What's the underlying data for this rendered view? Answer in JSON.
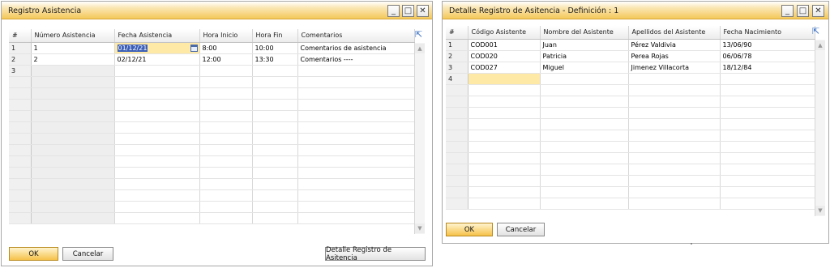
{
  "win1": {
    "title": "Registro Asistencia",
    "columns": [
      "#",
      "Número Asistencia",
      "Fecha Asistencia",
      "Hora Inicio",
      "Hora Fin",
      "Comentarios"
    ],
    "rows": [
      {
        "n": "1",
        "num": "1",
        "fecha": "01/12/21",
        "inicio": "8:00",
        "fin": "10:00",
        "coment": "Comentarios de asistencia"
      },
      {
        "n": "2",
        "num": "2",
        "fecha": "02/12/21",
        "inicio": "12:00",
        "fin": "13:30",
        "coment": "Comentarios ----"
      },
      {
        "n": "3",
        "num": "",
        "fecha": "",
        "inicio": "",
        "fin": "",
        "coment": ""
      }
    ],
    "ok_label": "OK",
    "cancel_label": "Cancelar",
    "detail_label": "Detalle Registro de Asitencia"
  },
  "win2": {
    "title": "Detalle Registro de Asitencia - Definición : 1",
    "columns": [
      "#",
      "Código Asistente",
      "Nombre del Asistente",
      "Apellidos del Asistente",
      "Fecha Nacimiento"
    ],
    "rows": [
      {
        "n": "1",
        "codigo": "COD001",
        "nombre": "Juan",
        "apellidos": "Pérez Valdivia",
        "fecha": "13/06/90"
      },
      {
        "n": "2",
        "codigo": "COD020",
        "nombre": "Patricia",
        "apellidos": "Perea Rojas",
        "fecha": "06/06/78"
      },
      {
        "n": "3",
        "codigo": "COD027",
        "nombre": "Miguel",
        "apellidos": "Jimenez Villacorta",
        "fecha": "18/12/84"
      },
      {
        "n": "4",
        "codigo": "",
        "nombre": "",
        "apellidos": "",
        "fecha": ""
      }
    ],
    "ok_label": "OK",
    "cancel_label": "Cancelar"
  },
  "window_buttons": {
    "minimize": "_",
    "maximize": "□",
    "close": "✕"
  },
  "icons": {
    "expand": "expand-arrow-icon",
    "calendar": "calendar-icon",
    "scroll_up": "scroll-up-icon",
    "scroll_down": "scroll-down-icon"
  },
  "colors": {
    "title_gradient": "#f4c85a",
    "ok_button": "#f6c24a",
    "selection": "#3b5fb8",
    "active_row": "#ffe9a6"
  }
}
